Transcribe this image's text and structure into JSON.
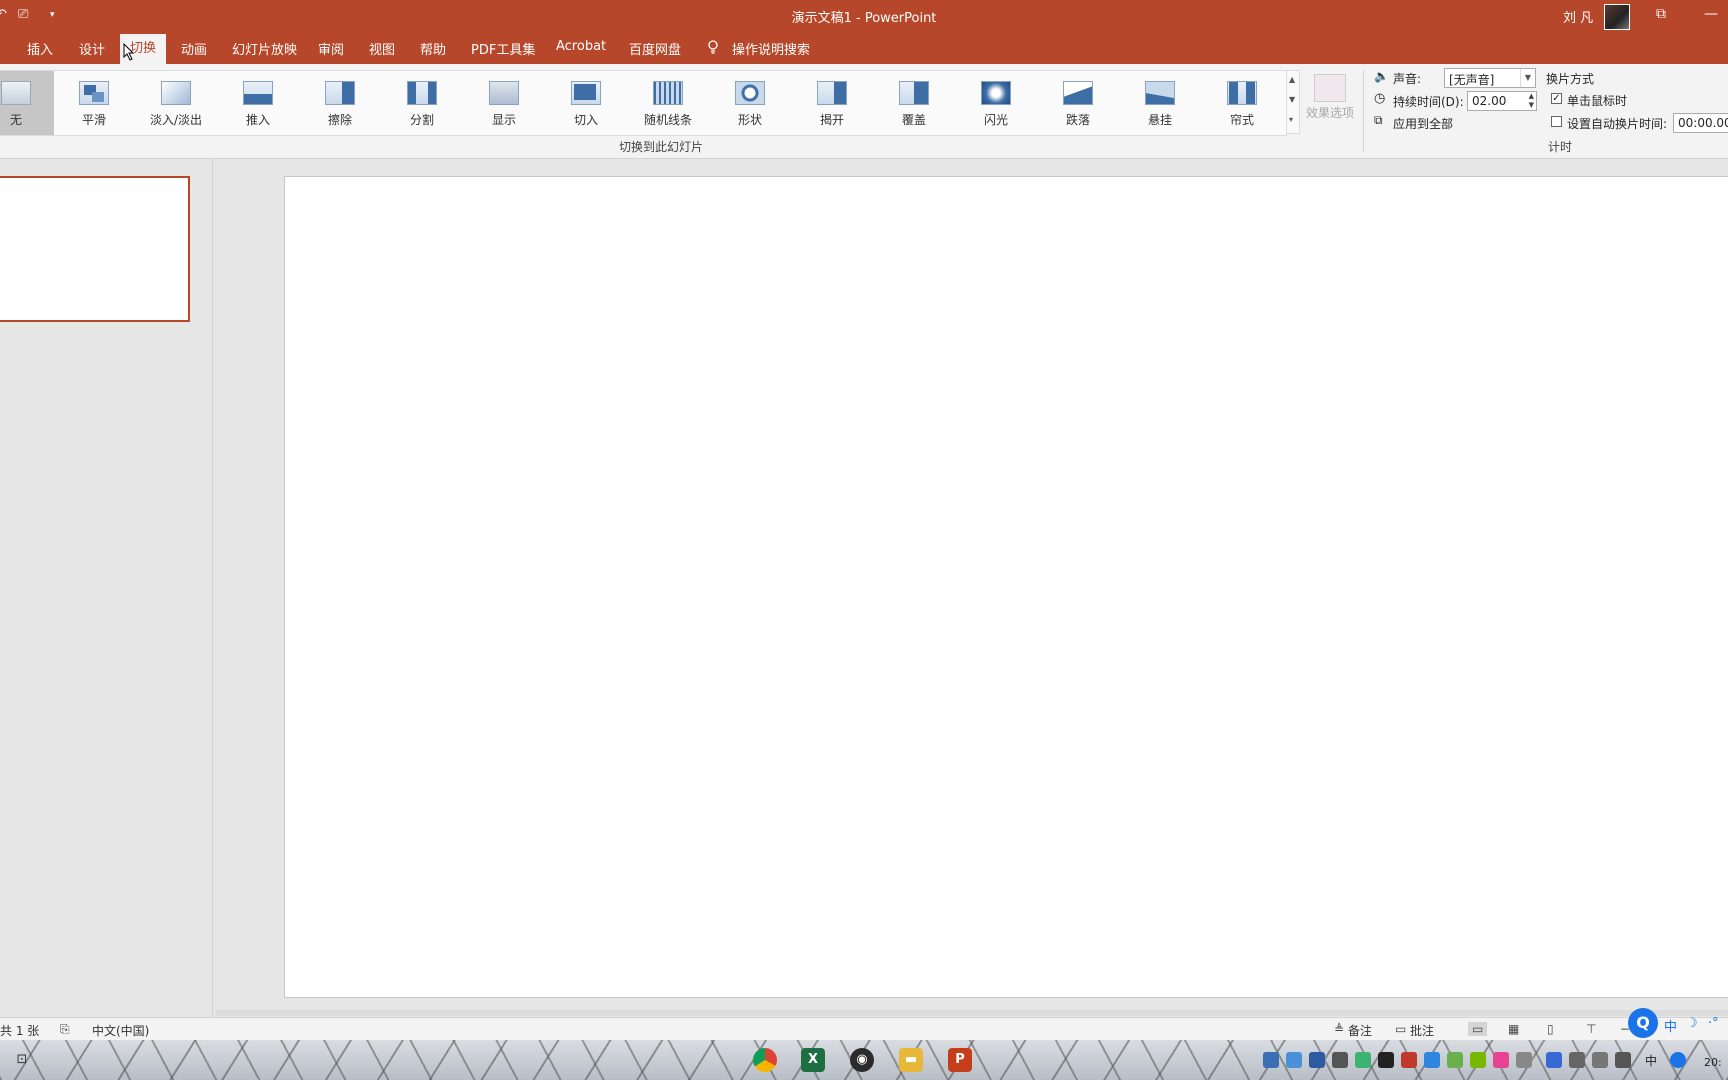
{
  "window": {
    "title": "演示文稿1  -  PowerPoint",
    "user": "刘 凡",
    "qa_arrow": "▾",
    "win_restore": "⧉",
    "win_minimize": "—"
  },
  "tabs": [
    {
      "label": "插入"
    },
    {
      "label": "设计"
    },
    {
      "label": "切换",
      "active": true
    },
    {
      "label": "动画"
    },
    {
      "label": "幻灯片放映"
    },
    {
      "label": "审阅"
    },
    {
      "label": "视图"
    },
    {
      "label": "帮助"
    },
    {
      "label": "PDF工具集"
    },
    {
      "label": "Acrobat"
    },
    {
      "label": "百度网盘"
    },
    {
      "label": "操作说明搜索"
    }
  ],
  "transitions": {
    "group_label": "切换到此幻灯片",
    "items": [
      {
        "label": "无",
        "selected": true
      },
      {
        "label": "平滑"
      },
      {
        "label": "淡入/淡出"
      },
      {
        "label": "推入"
      },
      {
        "label": "擦除"
      },
      {
        "label": "分割"
      },
      {
        "label": "显示"
      },
      {
        "label": "切入"
      },
      {
        "label": "随机线条"
      },
      {
        "label": "形状"
      },
      {
        "label": "揭开"
      },
      {
        "label": "覆盖"
      },
      {
        "label": "闪光"
      },
      {
        "label": "跌落"
      },
      {
        "label": "悬挂"
      },
      {
        "label": "帘式"
      }
    ],
    "effect_options": "效果选项"
  },
  "timing": {
    "group_label": "计时",
    "sound_label": "声音:",
    "sound_value": "[无声音]",
    "duration_label": "持续时间(D):",
    "duration_value": "02.00",
    "apply_all": "应用到全部",
    "advance_header": "换片方式",
    "on_click_label": "单击鼠标时",
    "on_click_checked": "✓",
    "auto_label": "设置自动换片时间:",
    "auto_value": "00:00.00"
  },
  "statusbar": {
    "slide_count": "共 1 张",
    "language": "中文(中国)",
    "notes": "备注",
    "comments": "批注"
  },
  "ime": {
    "logo": "Q",
    "lang": "中",
    "dots": "·°"
  },
  "taskbar": {
    "tray_lang": "中",
    "clock": "20:"
  },
  "colors": {
    "accent": "#b7472a",
    "ribbon_bg": "#f3f3f3",
    "workspace_bg": "#e6e6e6"
  }
}
